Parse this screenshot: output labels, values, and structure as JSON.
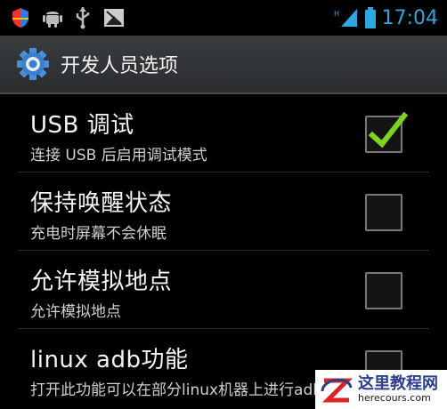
{
  "status_bar": {
    "left_icons": [
      "shield-icon",
      "android-icon",
      "usb-icon",
      "image-icon"
    ],
    "right_icons": [
      "signal-icon",
      "battery-icon"
    ],
    "time": "17:04",
    "time_color": "#2ea6df"
  },
  "action_bar": {
    "icon": "gear-icon",
    "title": "开发人员选项"
  },
  "settings": [
    {
      "title": "USB 调试",
      "summary": "连接 USB 后启用调试模式",
      "checked": true
    },
    {
      "title": "保持唤醒状态",
      "summary": "充电时屏幕不会休眠",
      "checked": false
    },
    {
      "title": "允许模拟地点",
      "summary": "允许模拟地点",
      "checked": false
    },
    {
      "title": "linux adb功能",
      "summary": "打开此功能可以在部分linux机器上进行adb操作",
      "checked": false
    }
  ],
  "check_color": "#7ed321",
  "watermark": {
    "name": "这里教程网",
    "url": "herecours.com"
  }
}
